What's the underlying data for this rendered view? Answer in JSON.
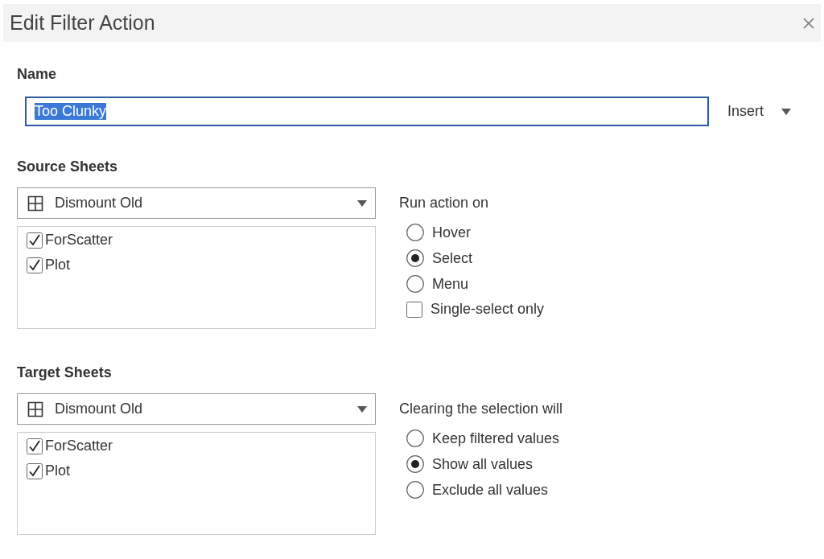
{
  "window": {
    "title": "Edit Filter Action"
  },
  "name": {
    "label": "Name",
    "value": "Too Clunky",
    "value_highlighted": true,
    "insert": "Insert"
  },
  "sections": [
    {
      "title": "Source Sheets",
      "dropdown": "Dismount Old",
      "sheets": [
        {
          "label": "ForScatter",
          "checked": true
        },
        {
          "label": "Plot",
          "checked": true
        }
      ],
      "options_title": "Run action on",
      "options": [
        {
          "kind": "radio",
          "label": "Hover",
          "selected": false
        },
        {
          "kind": "radio",
          "label": "Select",
          "selected": true
        },
        {
          "kind": "radio",
          "label": "Menu",
          "selected": false
        },
        {
          "kind": "checkbox",
          "label": "Single-select only",
          "checked": false
        }
      ]
    },
    {
      "title": "Target Sheets",
      "dropdown": "Dismount Old",
      "sheets": [
        {
          "label": "ForScatter",
          "checked": true
        },
        {
          "label": "Plot",
          "checked": true
        }
      ],
      "options_title": "Clearing the selection will",
      "options": [
        {
          "kind": "radio",
          "label": "Keep filtered values",
          "selected": false
        },
        {
          "kind": "radio",
          "label": "Show all values",
          "selected": true
        },
        {
          "kind": "radio",
          "label": "Exclude all values",
          "selected": false
        }
      ]
    }
  ]
}
